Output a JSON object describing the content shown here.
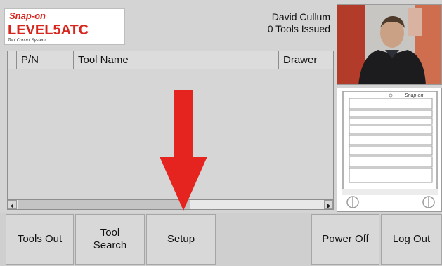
{
  "app": {
    "logo_brand": "Snap-on",
    "logo_product": "LEVEL5ATC",
    "logo_subtitle": "Tool Control System"
  },
  "header": {
    "user_name": "David Cullum",
    "tools_issued": "0 Tools Issued"
  },
  "table": {
    "columns": [
      "P/N",
      "Tool Name",
      "Drawer"
    ],
    "rows": []
  },
  "toolbar": {
    "tools_out": "Tools Out",
    "tool_search": "Tool\nSearch",
    "setup": "Setup",
    "power_off": "Power Off",
    "log_out": "Log Out"
  },
  "cabinet": {
    "brand": "Snap-on",
    "drawer_count": 8
  },
  "colors": {
    "accent_red": "#e5231f",
    "logo_red": "#d7261e",
    "panel_gray": "#d4d4d4"
  },
  "icons": [
    "profile-photo",
    "tool-cabinet-icon",
    "down-arrow-annotation"
  ]
}
